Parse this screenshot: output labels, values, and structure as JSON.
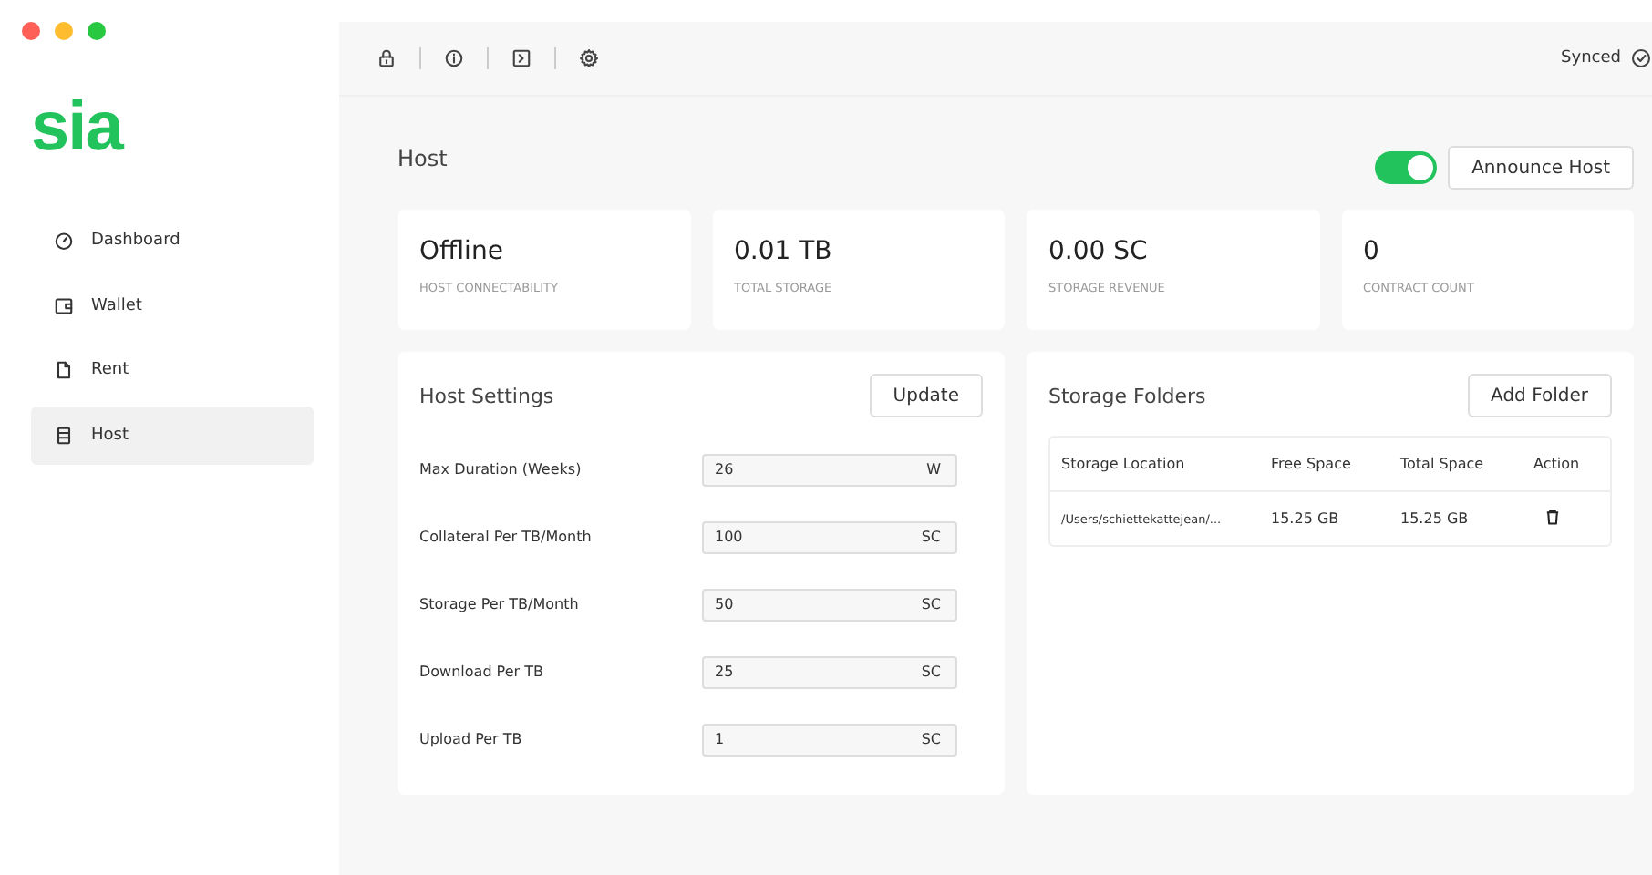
{
  "logo": "sia",
  "sidebar": {
    "items": [
      {
        "label": "Dashboard",
        "selected": false
      },
      {
        "label": "Wallet",
        "selected": false
      },
      {
        "label": "Rent",
        "selected": false
      },
      {
        "label": "Host",
        "selected": true
      }
    ]
  },
  "toolbar": {
    "status": "Synced"
  },
  "page": {
    "title": "Host",
    "announce_toggle": {
      "on": true
    },
    "announce_button": "Announce Host"
  },
  "stats": [
    {
      "value": "Offline",
      "label": "HOST CONNECTABILITY"
    },
    {
      "value": "0.01 TB",
      "label": "TOTAL STORAGE"
    },
    {
      "value": "0.00 SC",
      "label": "STORAGE REVENUE"
    },
    {
      "value": "0",
      "label": "CONTRACT COUNT"
    }
  ],
  "host_settings": {
    "title": "Host Settings",
    "button": "Update",
    "fields": [
      {
        "label": "Max Duration (Weeks)",
        "value": "26",
        "unit": "W"
      },
      {
        "label": "Collateral Per TB/Month",
        "value": "100",
        "unit": "SC"
      },
      {
        "label": "Storage Per TB/Month",
        "value": "50",
        "unit": "SC"
      },
      {
        "label": "Download Per TB",
        "value": "25",
        "unit": "SC"
      },
      {
        "label": "Upload Per TB",
        "value": "1",
        "unit": "SC"
      }
    ]
  },
  "storage_folders": {
    "title": "Storage Folders",
    "button": "Add Folder",
    "table": {
      "columns": [
        "Storage Location",
        "Free Space",
        "Total Space",
        "Action"
      ],
      "rows": [
        {
          "location": "/Users/schiettekattejean/...",
          "free": "15.25 GB",
          "total": "15.25 GB"
        }
      ]
    }
  }
}
